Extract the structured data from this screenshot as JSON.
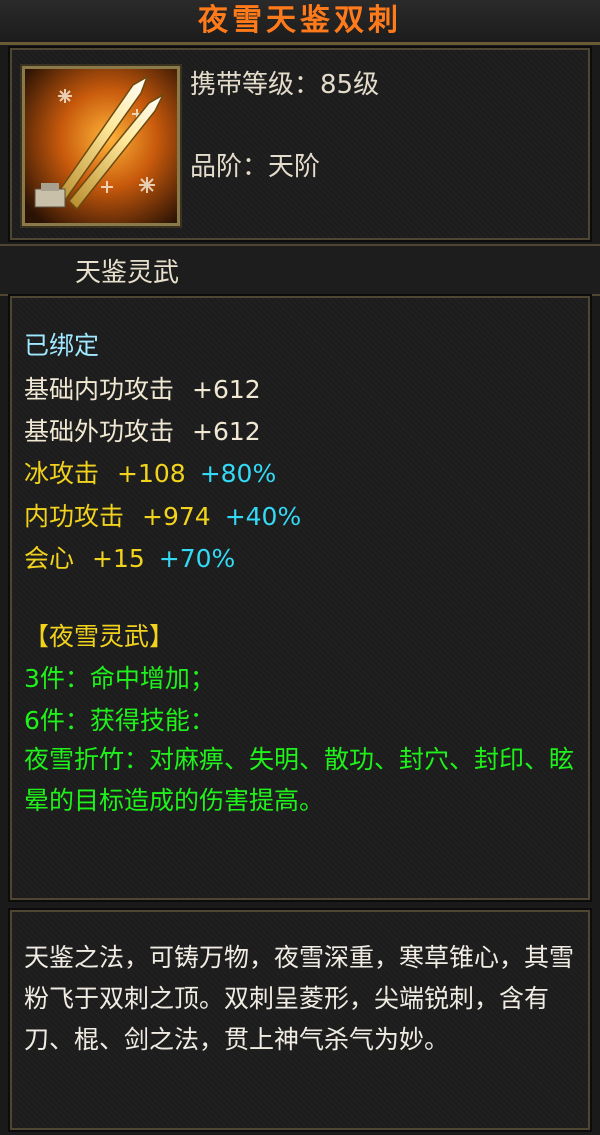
{
  "item": {
    "name": "夜雪天鉴双刺",
    "name_color": "#ff7a1a",
    "icon": "twin-blade-icon",
    "level_label": "携带等级：85级",
    "grade_label": "品阶：天阶",
    "set_series": "天鉴灵武"
  },
  "stats": {
    "bound": "已绑定",
    "base": [
      {
        "label": "基础内功攻击",
        "value": "+612"
      },
      {
        "label": "基础外功攻击",
        "value": "+612"
      }
    ],
    "bonus": [
      {
        "label": "冰攻击",
        "value": "+108",
        "pct": "+80%"
      },
      {
        "label": "内功攻击",
        "value": "+974",
        "pct": "+40%"
      },
      {
        "label": "会心",
        "value": "+15",
        "pct": "+70%"
      }
    ]
  },
  "set": {
    "name": "【夜雪灵武】",
    "piece3": "3件：命中增加；",
    "piece6": "6件：获得技能：",
    "skill_desc": "夜雪折竹：对麻痹、失明、散功、封穴、封印、眩晕的目标造成的伤害提高。"
  },
  "description": "天鉴之法，可铸万物，夜雪深重，寒草锥心，其雪粉飞于双刺之顶。双刺呈菱形，尖端锐刺，含有刀、棍、剑之法，贯上神气杀气为妙。",
  "colors": {
    "bound": "#9fe8ff",
    "base_stat": "#f0e8d2",
    "bonus_stat": "#f1d21c",
    "percent": "#33d9f5",
    "set_text": "#1ff21a"
  }
}
